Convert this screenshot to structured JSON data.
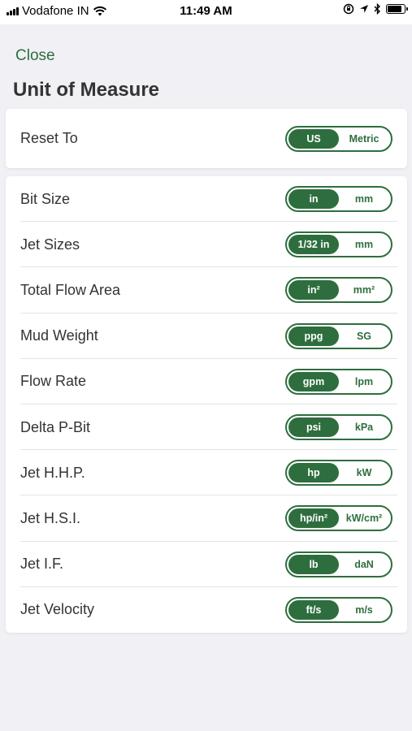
{
  "status_bar": {
    "carrier": "Vodafone IN",
    "time": "11:49 AM"
  },
  "header": {
    "close_label": "Close",
    "title": "Unit of Measure"
  },
  "reset": {
    "label": "Reset To",
    "options": [
      "US",
      "Metric"
    ],
    "selected": 0
  },
  "units": [
    {
      "label": "Bit Size",
      "options": [
        "in",
        "mm"
      ],
      "selected": 0
    },
    {
      "label": "Jet Sizes",
      "options": [
        "1/32 in",
        "mm"
      ],
      "selected": 0
    },
    {
      "label": "Total Flow Area",
      "options": [
        "in²",
        "mm²"
      ],
      "selected": 0
    },
    {
      "label": "Mud Weight",
      "options": [
        "ppg",
        "SG"
      ],
      "selected": 0
    },
    {
      "label": "Flow Rate",
      "options": [
        "gpm",
        "lpm"
      ],
      "selected": 0
    },
    {
      "label": "Delta P-Bit",
      "options": [
        "psi",
        "kPa"
      ],
      "selected": 0
    },
    {
      "label": "Jet H.H.P.",
      "options": [
        "hp",
        "kW"
      ],
      "selected": 0
    },
    {
      "label": "Jet H.S.I.",
      "options": [
        "hp/in²",
        "kW/cm²"
      ],
      "selected": 0
    },
    {
      "label": "Jet I.F.",
      "options": [
        "lb",
        "daN"
      ],
      "selected": 0
    },
    {
      "label": "Jet Velocity",
      "options": [
        "ft/s",
        "m/s"
      ],
      "selected": 0
    }
  ],
  "colors": {
    "accent": "#2e6e3e",
    "background": "#f0f0f5"
  },
  "icons": {
    "signal": "cellular-signal-icon",
    "wifi": "wifi-icon",
    "rotation_lock": "rotation-lock-icon",
    "location": "location-arrow-icon",
    "bluetooth": "bluetooth-icon",
    "battery": "battery-icon"
  }
}
